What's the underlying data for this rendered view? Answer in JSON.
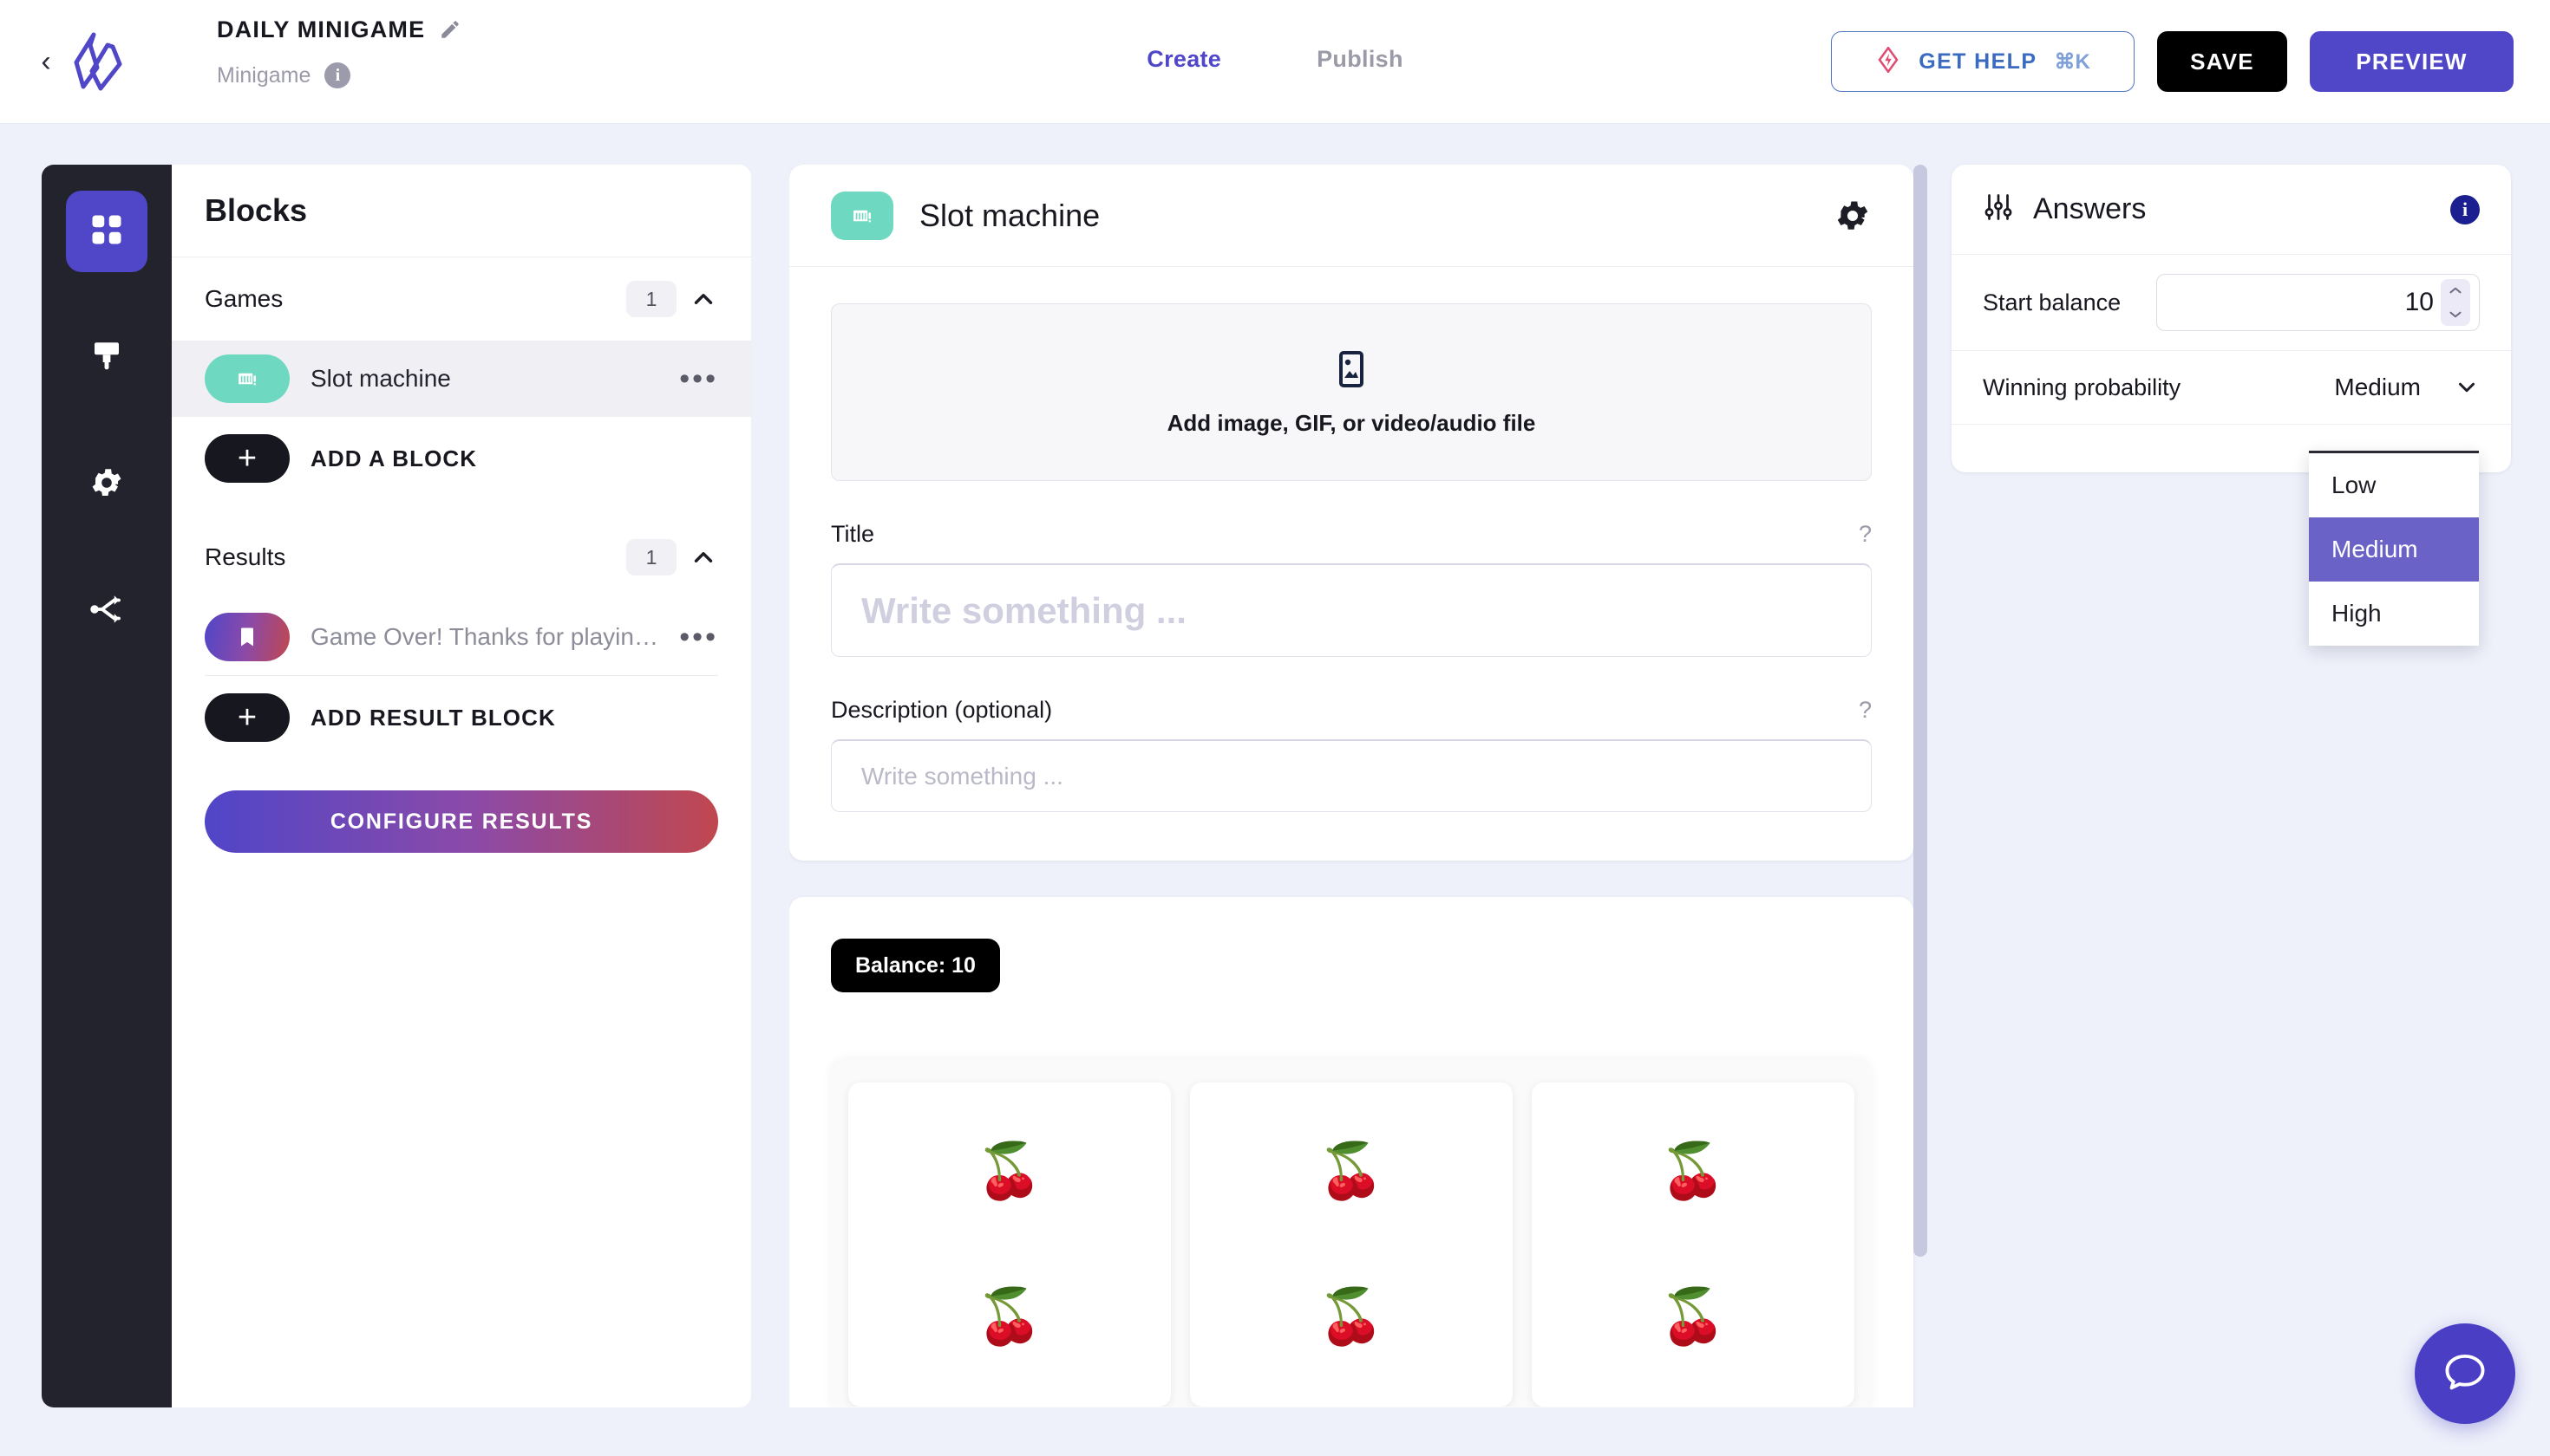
{
  "header": {
    "back_icon": "chevron-left-icon",
    "logo_icon": "brand-logo-icon",
    "project_title": "DAILY MINIGAME",
    "edit_icon": "pencil-icon",
    "project_type": "Minigame",
    "type_info_icon": "info-icon",
    "tabs": [
      {
        "label": "Create",
        "active": true
      },
      {
        "label": "Publish",
        "active": false
      }
    ],
    "help_button": {
      "label": "GET HELP",
      "shortcut": "⌘K",
      "icon": "lightning-diamond-icon"
    },
    "save_label": "SAVE",
    "preview_label": "PREVIEW"
  },
  "rail": {
    "items": [
      {
        "icon": "grid-blocks-icon",
        "active": true
      },
      {
        "icon": "paint-brush-icon",
        "active": false
      },
      {
        "icon": "gear-icon",
        "active": false
      },
      {
        "icon": "share-nodes-icon",
        "active": false
      }
    ]
  },
  "blocks": {
    "panel_title": "Blocks",
    "groups": [
      {
        "title": "Games",
        "count": "1",
        "collapse_icon": "chevron-up-icon",
        "items": [
          {
            "label": "Slot machine",
            "icon": "slot-machine-icon",
            "selected": true,
            "menu_icon": "ellipsis-icon"
          }
        ],
        "add_label": "ADD A BLOCK",
        "add_icon": "plus-icon"
      },
      {
        "title": "Results",
        "count": "1",
        "collapse_icon": "chevron-up-icon",
        "items": [
          {
            "label": "Game Over! Thanks for playin…",
            "icon": "bookmark-icon",
            "selected": false,
            "menu_icon": "ellipsis-icon"
          }
        ],
        "add_label": "ADD RESULT BLOCK",
        "add_icon": "plus-icon"
      }
    ],
    "configure_results_label": "CONFIGURE RESULTS"
  },
  "editor": {
    "block_icon": "slot-machine-icon",
    "block_title": "Slot machine",
    "settings_icon": "gear-icon",
    "media": {
      "icon": "image-placeholder-icon",
      "caption": "Add image, GIF, or video/audio file"
    },
    "title_field": {
      "label": "Title",
      "help_icon": "question-mark-icon",
      "value": "",
      "placeholder": "Write something ..."
    },
    "description_field": {
      "label": "Description (optional)",
      "help_icon": "question-mark-icon",
      "value": "",
      "placeholder": "Write something ..."
    },
    "preview": {
      "balance_label": "Balance: 10",
      "reels": [
        {
          "symbols": [
            "🍒",
            "🍒"
          ]
        },
        {
          "symbols": [
            "🍒",
            "🍒"
          ]
        },
        {
          "symbols": [
            "🍒",
            "🍒"
          ]
        }
      ]
    }
  },
  "answers": {
    "title": "Answers",
    "title_icon": "sliders-icon",
    "info_icon": "info-icon",
    "start_balance": {
      "label": "Start balance",
      "value": "10",
      "spinner_icon": "stepper-arrows-icon"
    },
    "winning_probability": {
      "label": "Winning probability",
      "value": "Medium",
      "chevron_icon": "chevron-down-icon",
      "options": [
        {
          "label": "Low",
          "selected": false
        },
        {
          "label": "Medium",
          "selected": true
        },
        {
          "label": "High",
          "selected": false
        }
      ]
    }
  },
  "chat": {
    "icon": "chat-bubble-icon"
  },
  "colors": {
    "accent": "#5046c8",
    "teal": "#6ed9c0",
    "dark": "#23232e",
    "bg": "#eef0fa",
    "dropdown_selected": "#6b62c8"
  }
}
